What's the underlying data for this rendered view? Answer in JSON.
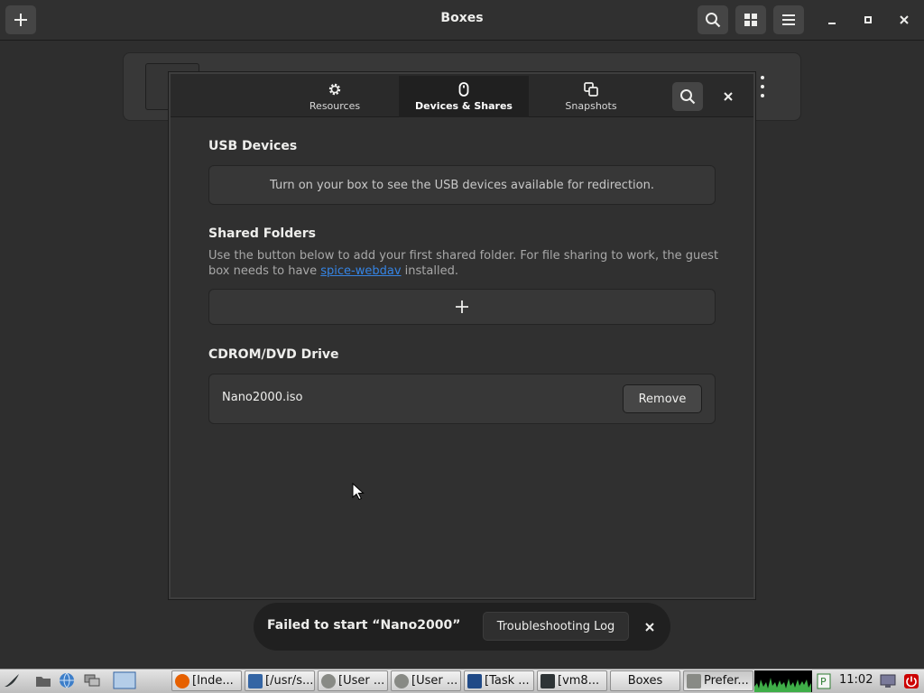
{
  "app": {
    "title": "Boxes",
    "icons": {
      "new": "plus-icon",
      "search": "search-icon",
      "view": "grid-icon",
      "menu": "hamburger-icon",
      "minimize": "minimize-icon",
      "maximize": "maximize-icon",
      "close": "close-icon"
    }
  },
  "dialog": {
    "tabs": [
      {
        "label": "Resources",
        "icon": "gear-icon",
        "active": false
      },
      {
        "label": "Devices & Shares",
        "icon": "mouse-icon",
        "active": true
      },
      {
        "label": "Snapshots",
        "icon": "snapshots-icon",
        "active": false
      }
    ],
    "usb": {
      "title": "USB Devices",
      "message": "Turn on your box to see the USB devices available for redirection."
    },
    "shared": {
      "title": "Shared Folders",
      "desc_before": "Use the button below to add your first shared folder. For file sharing to work, the guest box needs to have ",
      "link": "spice-webdav",
      "desc_after": " installed."
    },
    "cdrom": {
      "title": "CDROM/DVD Drive",
      "file": "Nano2000.iso",
      "remove_label": "Remove"
    }
  },
  "toast": {
    "message": "Failed to start “Nano2000”",
    "button": "Troubleshooting Log"
  },
  "taskbar": {
    "tasks": [
      {
        "label": "[Inde...",
        "icon_color": "#e66000"
      },
      {
        "label": "[/usr/s...",
        "icon_color": "#3465a4"
      },
      {
        "label": "[User ...",
        "icon_color": "#888a85"
      },
      {
        "label": "[User ...",
        "icon_color": "#888a85"
      },
      {
        "label": "[Task ...",
        "icon_color": "#204a87"
      },
      {
        "label": "[vm8...",
        "icon_color": "#2e3436"
      },
      {
        "label": "Boxes",
        "icon_color": ""
      },
      {
        "label": "Prefer...",
        "icon_color": "#888a85"
      }
    ],
    "clock": "11:02"
  },
  "colors": {
    "accent": "#3584e4",
    "background": "#2e2e2e",
    "dialog": "#303030",
    "toast": "#202020"
  }
}
